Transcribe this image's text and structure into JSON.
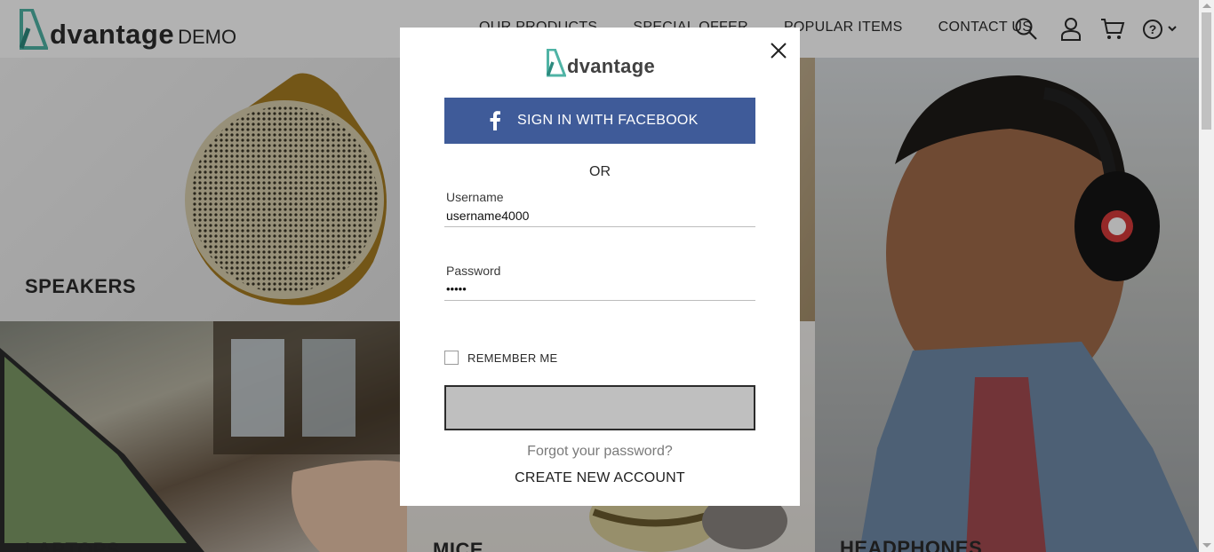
{
  "header": {
    "logo_text": "dvantage",
    "logo_suffix": "DEMO",
    "nav": [
      {
        "label": "OUR PRODUCTS"
      },
      {
        "label": "SPECIAL OFFER"
      },
      {
        "label": "POPULAR ITEMS"
      },
      {
        "label": "CONTACT US"
      }
    ],
    "icons": [
      "search-icon",
      "user-icon",
      "cart-icon",
      "help-icon"
    ]
  },
  "categories": {
    "speakers": "SPEAKERS",
    "laptops": "LAPTOPS",
    "mice": "MICE",
    "headphones": "HEADPHONES"
  },
  "modal": {
    "logo_text": "dvantage",
    "facebook_label": "SIGN IN WITH FACEBOOK",
    "or_text": "OR",
    "username_label": "Username",
    "username_value": "username4000",
    "password_label": "Password",
    "password_value": "•••••",
    "remember_label": "REMEMBER ME",
    "signin_label": "",
    "forgot_label": "Forgot your password?",
    "create_label": "CREATE NEW ACCOUNT"
  },
  "colors": {
    "brand_teal": "#4fb3a5",
    "facebook_blue": "#3f5b99",
    "signin_disabled": "#bfbfbf"
  }
}
